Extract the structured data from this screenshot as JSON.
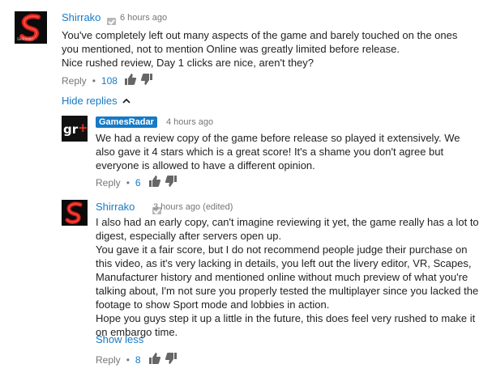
{
  "comment": {
    "author": "Shirrako",
    "avatar_letter": "S",
    "time": "6 hours ago",
    "text": "You've completely left out many aspects of the game and barely touched on the ones you mentioned, not to mention Online was greatly limited before release.\nNice rushed review, Day 1 clicks are nice, aren't they?",
    "reply_label": "Reply",
    "separator": "•",
    "likes": "108"
  },
  "hide_replies_label": "Hide replies",
  "replies": [
    {
      "author": "GamesRadar",
      "avatar_text": "gr+",
      "time": "4 hours ago",
      "text": "We had a review copy of the game before release so played it extensively. We also gave it 4 stars which is a great score! It's a shame you don't agree but everyone is allowed to have a different opinion.",
      "reply_label": "Reply",
      "separator": "•",
      "likes": "6"
    },
    {
      "author": "Shirrako",
      "avatar_letter": "S",
      "time": "3 hours ago (edited)",
      "text": "I also had an early copy, can't imagine reviewing it yet, the game really has a lot to digest, especially after servers open up.\nYou gave it a fair score, but I do not recommend people judge their purchase on this video, as it's very lacking in details, you left out the livery editor, VR, Scapes, Manufacturer history and mentioned online without much preview of what you're talking about, I'm not sure you properly tested the multiplayer since you lacked the footage to show Sport mode and lobbies in action.\nHope you guys step it up a little in the future, this does feel very rushed to make it on embargo time.",
      "show_less_label": "Show less",
      "reply_label": "Reply",
      "separator": "•",
      "likes": "8"
    }
  ],
  "colors": {
    "link": "#167ac6",
    "meta": "#767676",
    "text": "#222222",
    "icon": "#666666"
  }
}
